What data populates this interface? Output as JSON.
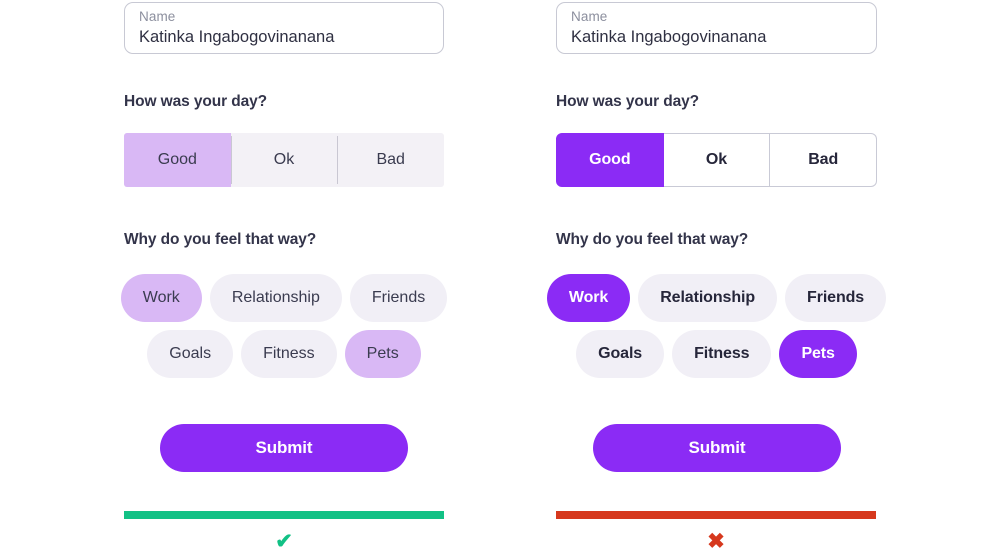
{
  "panels": [
    {
      "id": "plain",
      "name_field": {
        "label": "Name",
        "value": "Katinka Ingabogovinanana",
        "placeholder": "Name"
      },
      "day_question": {
        "heading": "How was your day?",
        "options": [
          "Good",
          "Ok",
          "Bad"
        ],
        "selected": "Good"
      },
      "why_question": {
        "heading": "Why do you feel that way?",
        "row1": [
          "Work",
          "Relationship",
          "Friends"
        ],
        "row2": [
          "Goals",
          "Fitness",
          "Pets"
        ],
        "selected": [
          "Work",
          "Pets"
        ]
      },
      "submit_label": "Submit",
      "result": {
        "mark": "✔",
        "bar_color": "#12c185",
        "mark_color": "#12c185"
      }
    },
    {
      "id": "styled",
      "name_field": {
        "label": "Name",
        "value": "Katinka Ingabogovinanana",
        "placeholder": "Name"
      },
      "day_question": {
        "heading": "How was your day?",
        "options": [
          "Good",
          "Ok",
          "Bad"
        ],
        "selected": "Good"
      },
      "why_question": {
        "heading": "Why do you feel that way?",
        "row1": [
          "Work",
          "Relationship",
          "Friends"
        ],
        "row2": [
          "Goals",
          "Fitness",
          "Pets"
        ],
        "selected": [
          "Work",
          "Pets"
        ]
      },
      "submit_label": "Submit",
      "result": {
        "mark": "✖",
        "bar_color": "#d6381d",
        "mark_color": "#d6381d"
      }
    }
  ],
  "colors": {
    "accent_vivid": "#8b2bf5",
    "accent_soft": "#d9b8f5",
    "neutral_fill": "#f1eff6",
    "neutral_fill_alt": "#f3f1f6",
    "text_dark": "#33344a",
    "text_muted": "#8c8f9e",
    "border": "#c9cad6",
    "success": "#12c185",
    "error": "#d6381d"
  }
}
